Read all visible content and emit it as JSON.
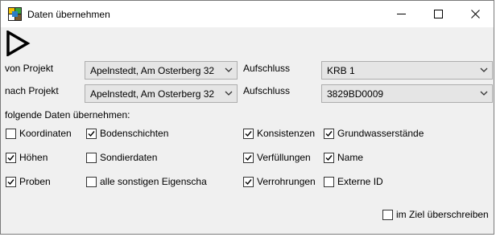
{
  "window": {
    "title": "Daten übernehmen",
    "icon": "app-logo-icon"
  },
  "toolbar": {
    "run_icon": "play-icon"
  },
  "source": {
    "project_label": "von Projekt",
    "project_value": "Apelnstedt, Am Osterberg 32",
    "outcrop_label": "Aufschluss",
    "outcrop_value": "KRB 1"
  },
  "target": {
    "project_label": "nach Projekt",
    "project_value": "Apelnstedt, Am Osterberg 32",
    "outcrop_label": "Aufschluss",
    "outcrop_value": "3829BD0009"
  },
  "section_label": "folgende Daten übernehmen:",
  "options": [
    {
      "label": "Koordinaten",
      "checked": false
    },
    {
      "label": "Bodenschichten",
      "checked": true
    },
    {
      "label": "Konsistenzen",
      "checked": true
    },
    {
      "label": "Grundwasserstände",
      "checked": true
    },
    {
      "label": "Höhen",
      "checked": true
    },
    {
      "label": "Sondierdaten",
      "checked": false
    },
    {
      "label": "Verfüllungen",
      "checked": true
    },
    {
      "label": "Name",
      "checked": true
    },
    {
      "label": "Proben",
      "checked": true
    },
    {
      "label": "alle sonstigen Eigenscha",
      "checked": false
    },
    {
      "label": "Verrohrungen",
      "checked": true
    },
    {
      "label": "Externe ID",
      "checked": false
    }
  ],
  "overwrite": {
    "label": "im Ziel überschreiben",
    "checked": false
  },
  "colors": {
    "window_bg": "#f0f0f0",
    "combo_bg": "#e5e5e5",
    "titlebar_bg": "#ffffff"
  }
}
